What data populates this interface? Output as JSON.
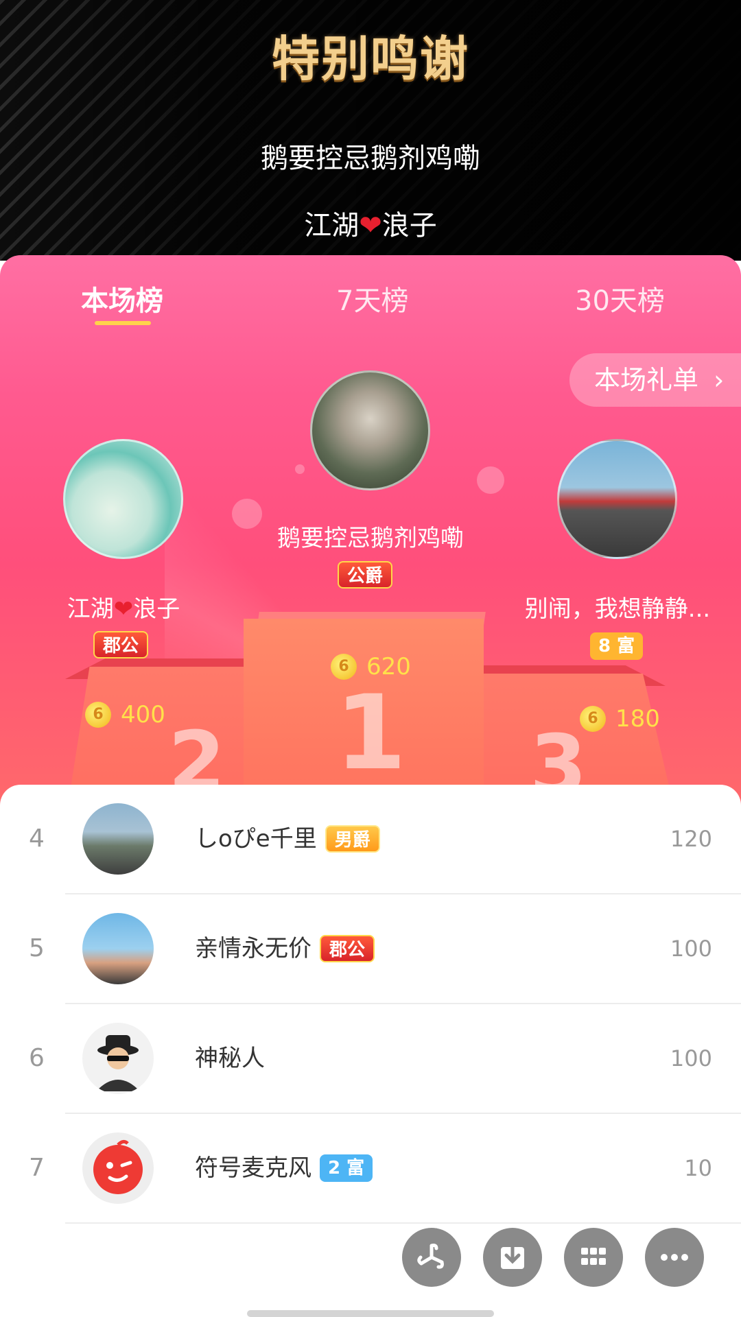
{
  "header": {
    "title": "特别鸣谢",
    "thanks_line_1": "鹅要控忌鹅剂鸡嘞",
    "thanks_line_2_prefix": "江湖",
    "thanks_line_2_suffix": "浪子"
  },
  "tabs": [
    {
      "label": "本场榜",
      "active": true
    },
    {
      "label": "7天榜",
      "active": false
    },
    {
      "label": "30天榜",
      "active": false
    }
  ],
  "gift_button": {
    "label": "本场礼单",
    "icon": "chevron-right-icon"
  },
  "podium": {
    "first": {
      "name": "鹅要控忌鹅剂鸡嘞",
      "badge": "公爵",
      "coins": "620",
      "rank_digit": "1"
    },
    "second": {
      "name_prefix": "江湖",
      "name_suffix": "浪子",
      "badge": "郡公",
      "coins": "400",
      "rank_digit": "2"
    },
    "third": {
      "name": "别闹，我想静静...",
      "badge": "8 富",
      "coins": "180",
      "rank_digit": "3"
    },
    "coin_glyph": "6"
  },
  "list": [
    {
      "rank": "4",
      "name": "しoぴe千里",
      "badge": "男爵",
      "badge_style": "orange",
      "value": "120"
    },
    {
      "rank": "5",
      "name": "亲情永无价",
      "badge": "郡公",
      "badge_style": "red",
      "value": "100"
    },
    {
      "rank": "6",
      "name": "神秘人",
      "badge": "",
      "badge_style": "",
      "value": "100"
    },
    {
      "rank": "7",
      "name": "符号麦克风",
      "badge": "2 富",
      "badge_style": "rich-blue",
      "value": "10"
    }
  ],
  "fabs": [
    {
      "icon": "pinwheel-icon"
    },
    {
      "icon": "download-icon"
    },
    {
      "icon": "grid-icon"
    },
    {
      "icon": "more-icon"
    }
  ],
  "colors": {
    "panel_pink": "#ff5a8f",
    "title_gold": "#f3cf8d",
    "tab_indicator": "#ffd24b",
    "coin_yellow": "#ffe14a"
  }
}
